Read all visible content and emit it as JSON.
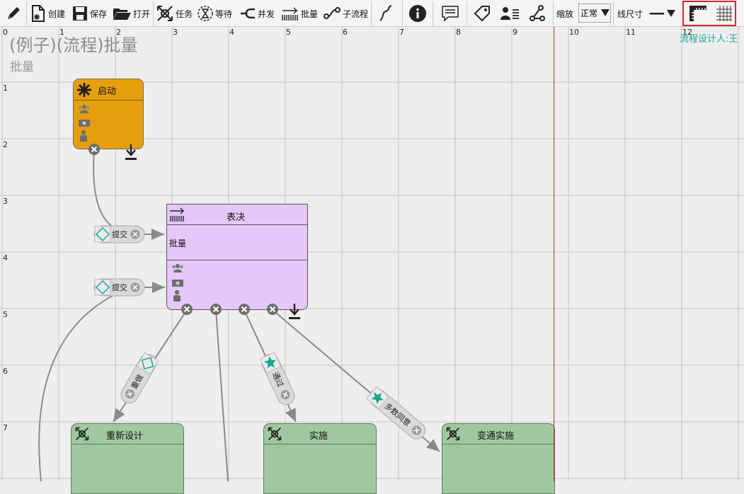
{
  "toolbar": {
    "create": "创建",
    "save": "保存",
    "open": "打开",
    "task": "任务",
    "wait": "等待",
    "parallel": "并发",
    "batch": "批量",
    "subflow": "子流程",
    "zoom_label": "缩放",
    "zoom_value": "正常",
    "line_size_label": "线尺寸"
  },
  "header": {
    "title": "(例子)(流程)批量",
    "subtitle": "批量",
    "designer": "流程设计人:王"
  },
  "ruler": {
    "columns": [
      "0",
      "1",
      "2",
      "3",
      "4",
      "5",
      "6",
      "7",
      "8",
      "9",
      "10",
      "11",
      "12"
    ],
    "rows": [
      "1",
      "2",
      "3",
      "4",
      "5",
      "6",
      "7"
    ]
  },
  "nodes": {
    "start": {
      "title": "启动",
      "color": "#e69e0c"
    },
    "vote": {
      "title": "表决",
      "body": "批量",
      "color": "#e5c8fb"
    },
    "redesign": {
      "title": "重新设计",
      "color": "#a0c89e"
    },
    "implement": {
      "title": "实施",
      "color": "#a0c89e"
    },
    "alt_implement": {
      "title": "变通实施",
      "color": "#a0c89e"
    }
  },
  "transitions": {
    "submit1": "提交",
    "submit2": "提交",
    "redo": "重做",
    "pass": "通过",
    "majority": "多数同意"
  },
  "colors": {
    "accent_red": "#d42a2a",
    "teal": "#1aa691",
    "line": "#8a8a8a"
  }
}
